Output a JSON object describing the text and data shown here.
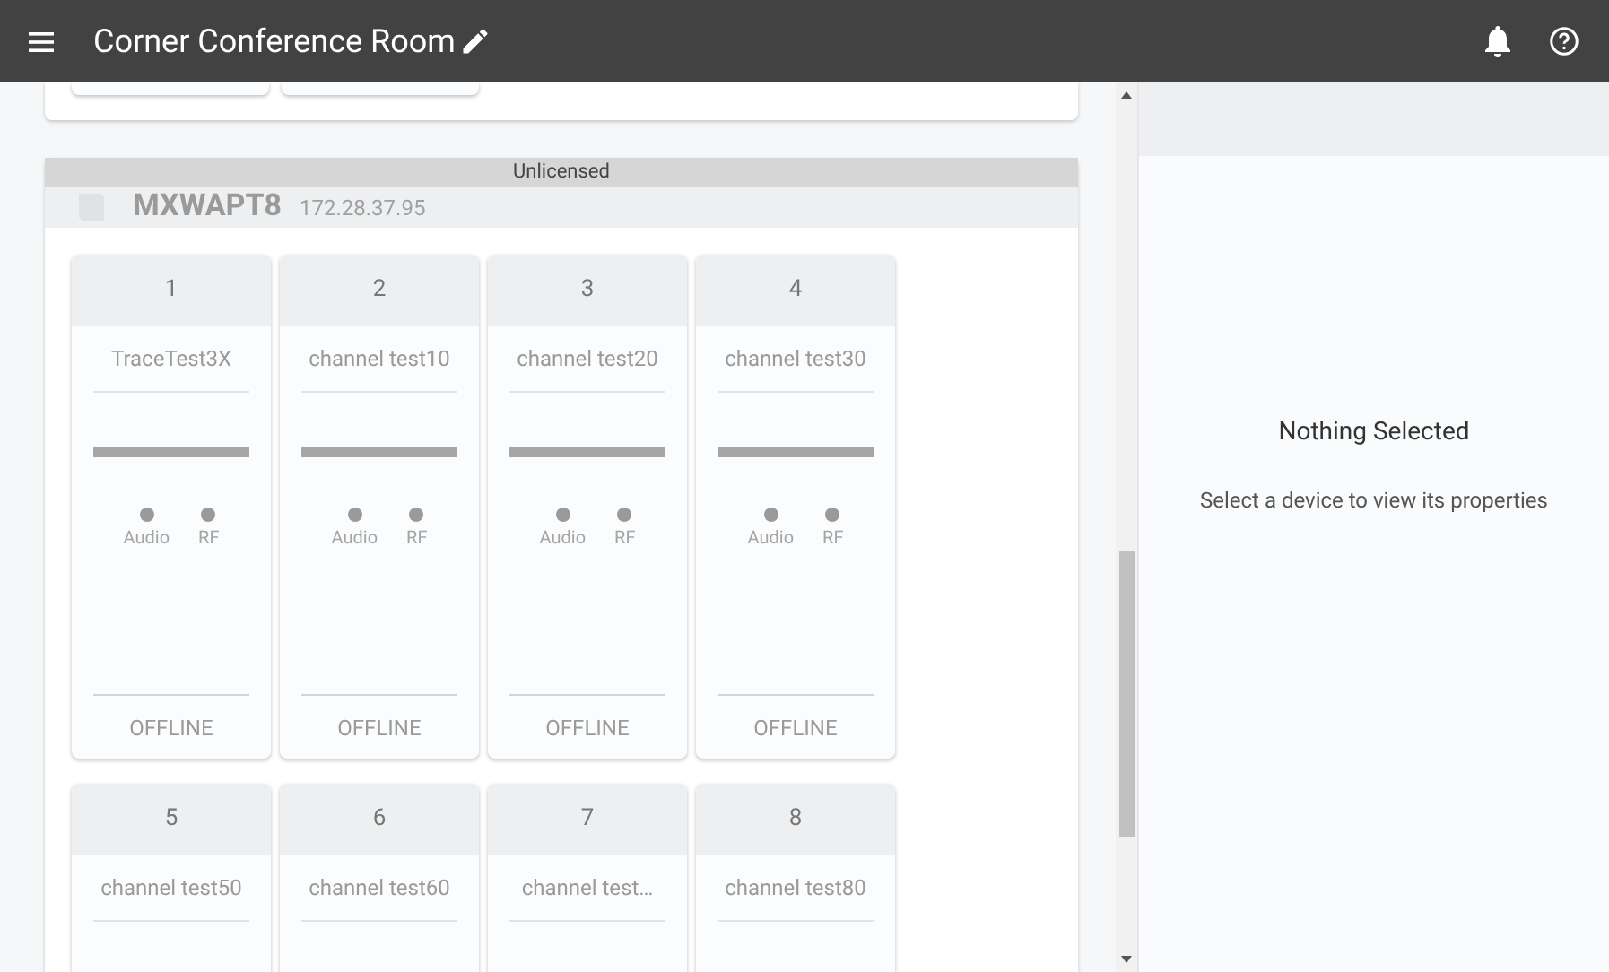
{
  "header": {
    "title": "Corner Conference Room"
  },
  "device": {
    "license": "Unlicensed",
    "model": "MXWAPT8",
    "ip": "172.28.37.95",
    "channels": [
      {
        "number": "1",
        "name": "TraceTest3X",
        "indicators": [
          "Audio",
          "RF"
        ],
        "status": "OFFLINE"
      },
      {
        "number": "2",
        "name": "channel test10",
        "indicators": [
          "Audio",
          "RF"
        ],
        "status": "OFFLINE"
      },
      {
        "number": "3",
        "name": "channel test20",
        "indicators": [
          "Audio",
          "RF"
        ],
        "status": "OFFLINE"
      },
      {
        "number": "4",
        "name": "channel test30",
        "indicators": [
          "Audio",
          "RF"
        ],
        "status": "OFFLINE"
      },
      {
        "number": "5",
        "name": "channel test50"
      },
      {
        "number": "6",
        "name": "channel test60"
      },
      {
        "number": "7",
        "name": "channel test…"
      },
      {
        "number": "8",
        "name": "channel test80"
      }
    ]
  },
  "properties": {
    "title": "Nothing Selected",
    "message": "Select a device to view its properties"
  }
}
